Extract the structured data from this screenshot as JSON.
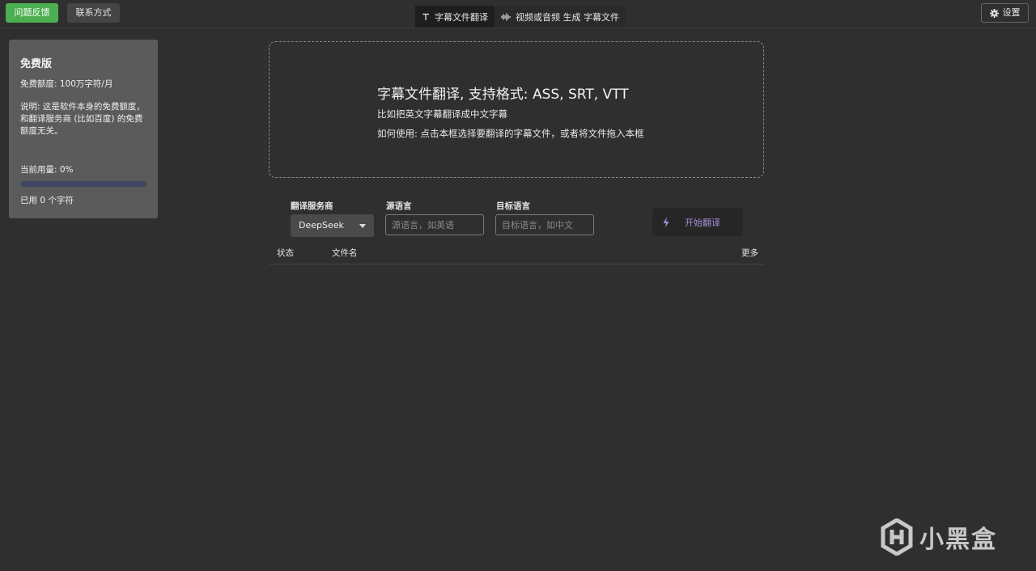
{
  "topbar": {
    "feedback_label": "问题反馈",
    "contact_label": "联系方式",
    "settings_label": "设置",
    "tabs": [
      {
        "label": "字幕文件翻译",
        "icon": "text-icon",
        "active": true
      },
      {
        "label": "视频或音频 生成 字幕文件",
        "icon": "waveform-icon",
        "active": false
      }
    ]
  },
  "quota": {
    "title": "免费版",
    "limit": "免费额度: 100万字符/月",
    "description": "说明: 这是软件本身的免费额度，和翻译服务商 (比如百度) 的免费额度无关。",
    "usage": "当前用量: 0%",
    "usage_fraction": 0,
    "used": "已用 0 个字符"
  },
  "dropzone": {
    "title": "字幕文件翻译, 支持格式: ASS, SRT, VTT",
    "example": "比如把英文字幕翻译成中文字幕",
    "howto": "如何使用: 点击本框选择要翻译的字幕文件，或者将文件拖入本框"
  },
  "form": {
    "provider_label": "翻译服务商",
    "provider_value": "DeepSeek",
    "source_label": "源语言",
    "source_placeholder": "源语言，如英语",
    "target_label": "目标语言",
    "target_placeholder": "目标语言，如中文",
    "start_label": "开始翻译"
  },
  "table": {
    "columns": [
      "状态",
      "文件名",
      "更多"
    ]
  },
  "watermark": {
    "text": "小黑盒"
  },
  "colors": {
    "background": "#2f2f2f",
    "feedback_green": "#4caf50",
    "panel": "#5b5b5b",
    "accent_purple": "#a68fd6",
    "progress_track": "#3f4660"
  }
}
